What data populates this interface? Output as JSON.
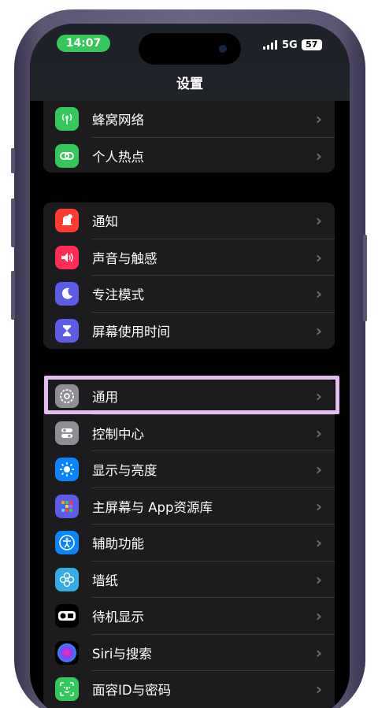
{
  "status_bar": {
    "time": "14:07",
    "network": "5G",
    "battery": "57"
  },
  "header": {
    "title": "设置"
  },
  "groups": [
    [
      {
        "label": "蜂窝网络",
        "icon": "cellular-icon",
        "color": "#34c759"
      },
      {
        "label": "个人热点",
        "icon": "hotspot-icon",
        "color": "#34c759"
      }
    ],
    [
      {
        "label": "通知",
        "icon": "notifications-icon",
        "color": "#ff3b30"
      },
      {
        "label": "声音与触感",
        "icon": "sound-icon",
        "color": "#ff2d55"
      },
      {
        "label": "专注模式",
        "icon": "focus-moon-icon",
        "color": "#5e5ce6"
      },
      {
        "label": "屏幕使用时间",
        "icon": "hourglass-icon",
        "color": "#5e5ce6"
      }
    ],
    [
      {
        "label": "通用",
        "icon": "gear-icon",
        "color": "#8e8e93"
      },
      {
        "label": "控制中心",
        "icon": "control-center-icon",
        "color": "#8e8e93"
      },
      {
        "label": "显示与亮度",
        "icon": "brightness-icon",
        "color": "#0a84ff"
      },
      {
        "label": "主屏幕与 App资源库",
        "icon": "home-screen-icon",
        "color": "#5e5ce6"
      },
      {
        "label": "辅助功能",
        "icon": "accessibility-icon",
        "color": "#0a84ff"
      },
      {
        "label": "墙纸",
        "icon": "wallpaper-icon",
        "color": "#32ade6"
      },
      {
        "label": "待机显示",
        "icon": "standby-icon",
        "color": "#000000"
      },
      {
        "label": "Siri与搜索",
        "icon": "siri-icon",
        "color": "#000000"
      },
      {
        "label": "面容ID与密码",
        "icon": "face-id-icon",
        "color": "#34c759"
      }
    ]
  ],
  "chevron": "›"
}
